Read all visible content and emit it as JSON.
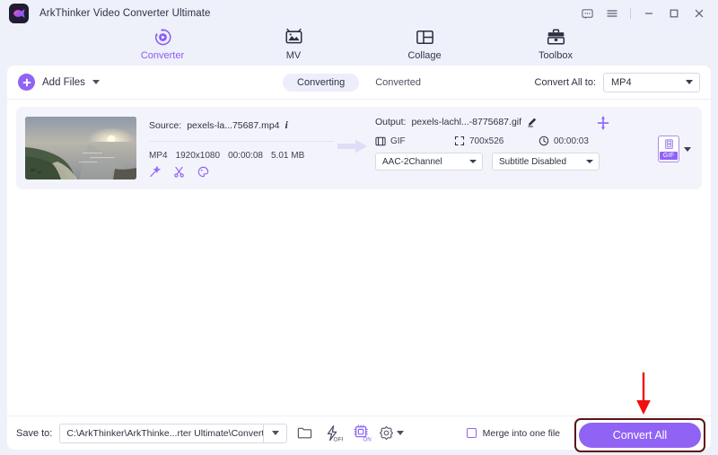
{
  "window": {
    "title": "ArkThinker Video Converter Ultimate",
    "controls": [
      {
        "name": "feedback-icon",
        "glyph": "speech-bubble"
      },
      {
        "name": "menu-icon",
        "glyph": "hamburger"
      },
      {
        "name": "minimize-icon",
        "glyph": "minus"
      },
      {
        "name": "maximize-icon",
        "glyph": "square"
      },
      {
        "name": "close-icon",
        "glyph": "x"
      }
    ]
  },
  "nav": {
    "items": [
      {
        "label": "Converter",
        "icon": "converter-icon",
        "active": true
      },
      {
        "label": "MV",
        "icon": "mv-icon",
        "active": false
      },
      {
        "label": "Collage",
        "icon": "collage-icon",
        "active": false
      },
      {
        "label": "Toolbox",
        "icon": "toolbox-icon",
        "active": false
      }
    ]
  },
  "toolbar": {
    "add_files_label": "Add Files",
    "tabs": [
      {
        "label": "Converting",
        "selected": true
      },
      {
        "label": "Converted",
        "selected": false
      }
    ],
    "convert_all_to_label": "Convert All to:",
    "convert_all_to_value": "MP4"
  },
  "file": {
    "source_label": "Source:",
    "source_name": "pexels-la...75687.mp4",
    "meta": [
      "MP4",
      "1920x1080",
      "00:00:08",
      "5.01 MB"
    ],
    "tools": [
      "magic-wand-icon",
      "scissors-icon",
      "palette-icon"
    ],
    "output_label": "Output:",
    "output_name": "pexels-lachl...-8775687.gif",
    "out_format": "GIF",
    "out_resolution": "700x526",
    "out_duration": "00:00:03",
    "audio_track": "AAC-2Channel",
    "subtitle": "Subtitle Disabled",
    "format_badge": "GIF"
  },
  "bottom": {
    "save_to_label": "Save to:",
    "save_to_path": "C:\\ArkThinker\\ArkThinke...rter Ultimate\\Converted",
    "hw_accel_label": "OFF",
    "gpu_label": "ON",
    "merge_label": "Merge into one file",
    "merge_checked": false,
    "convert_all_button": "Convert All"
  },
  "annotation": {
    "arrow_color": "#f01010",
    "highlight_color": "#5d1414"
  },
  "colors": {
    "accent": "#9063f5",
    "app_bg": "#eef0fa",
    "panel_bg": "#ffffff",
    "card_bg": "#f3f4fb"
  }
}
